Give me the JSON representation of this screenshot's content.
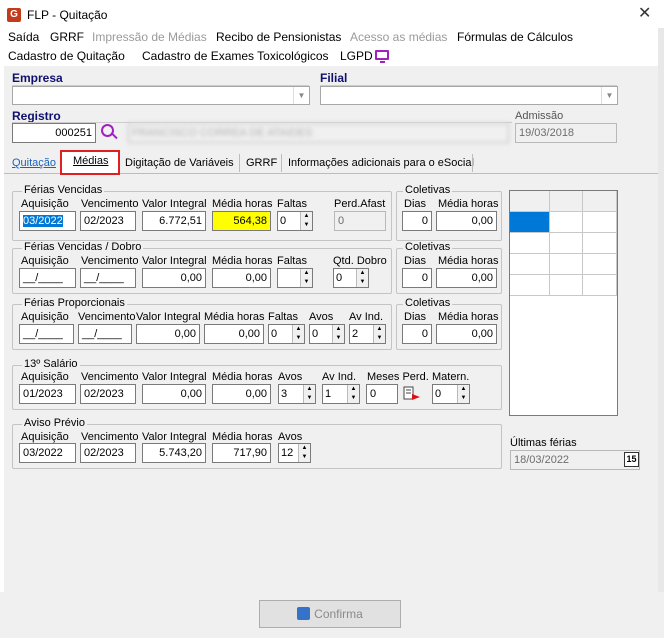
{
  "window": {
    "title": "FLP - Quitação",
    "app_icon": "G"
  },
  "menu": {
    "row1": [
      "Saída",
      "GRRF",
      "Impressão de Médias",
      "Recibo de Pensionistas",
      "Acesso as médias",
      "Fórmulas de Cálculos"
    ],
    "row2": [
      "Cadastro de Quitação",
      "Cadastro de Exames Toxicológicos",
      "LGPD"
    ]
  },
  "header": {
    "empresa_label": "Empresa",
    "filial_label": "Filial",
    "registro_label": "Registro",
    "registro_value": "000251",
    "nome_value": "FRANCISCO CORREA DE ATAIDES",
    "admissao_label": "Admissão",
    "admissao_value": "19/03/2018"
  },
  "tabs": [
    "Quitação",
    "Médias",
    "Digitação de Variáveis",
    "GRRF",
    "Informações adicionais para o eSocial"
  ],
  "ferias_vencidas": {
    "title": "Férias Vencidas",
    "labels": [
      "Aquisição",
      "Vencimento",
      "Valor Integral",
      "Média horas",
      "Faltas",
      "Perd.Afast"
    ],
    "aquisicao": "03/2022",
    "vencimento": "02/2023",
    "valor": "6.772,51",
    "media": "564,38",
    "faltas": "0",
    "perd": "0"
  },
  "ferias_dobro": {
    "title": "Férias Vencidas / Dobro",
    "labels": [
      "Aquisição",
      "Vencimento",
      "Valor Integral",
      "Média horas",
      "Faltas",
      "Qtd. Dobro"
    ],
    "aquisicao": "__/____",
    "vencimento": "__/____",
    "valor": "0,00",
    "media": "0,00",
    "faltas": "",
    "qtd": "0"
  },
  "ferias_prop": {
    "title": "Férias Proporcionais",
    "labels": [
      "Aquisição",
      "Vencimento",
      "Valor Integral",
      "Média horas",
      "Faltas",
      "Avos",
      "Av Ind."
    ],
    "aquisicao": "__/____",
    "vencimento": "__/____",
    "valor": "0,00",
    "media": "0,00",
    "faltas": "0",
    "avos": "0",
    "avind": "2"
  },
  "coletivas": {
    "title": "Coletivas",
    "labels": [
      "Dias",
      "Média horas"
    ],
    "rows": [
      [
        "0",
        "0,00"
      ],
      [
        "0",
        "0,00"
      ],
      [
        "0",
        "0,00"
      ]
    ]
  },
  "decimo": {
    "title": "13º Salário",
    "labels": [
      "Aquisição",
      "Vencimento",
      "Valor Integral",
      "Média horas",
      "Avos",
      "Av Ind.",
      "Meses Perd.",
      "Matern."
    ],
    "aquisicao": "01/2023",
    "vencimento": "02/2023",
    "valor": "0,00",
    "media": "0,00",
    "avos": "3",
    "avind": "1",
    "meses": "0",
    "matern": "0"
  },
  "aviso": {
    "title": "Aviso Prévio",
    "labels": [
      "Aquisição",
      "Vencimento",
      "Valor Integral",
      "Média horas",
      "Avos"
    ],
    "aquisicao": "03/2022",
    "vencimento": "02/2023",
    "valor": "5.743,20",
    "media": "717,90",
    "avos": "12"
  },
  "ultimas": {
    "label": "Últimas férias",
    "value": "18/03/2022",
    "cal": "15"
  },
  "footer": {
    "confirma": "Confirma"
  }
}
